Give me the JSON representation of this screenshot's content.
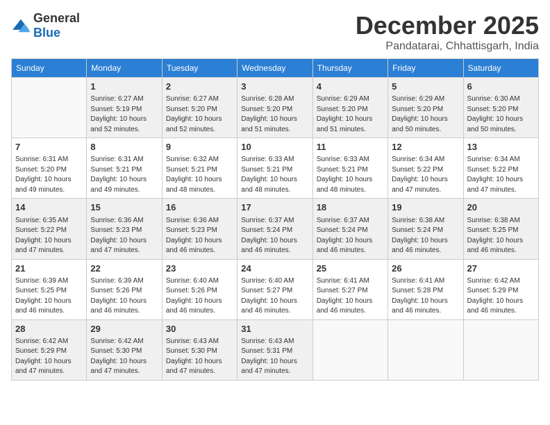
{
  "logo": {
    "general": "General",
    "blue": "Blue"
  },
  "title": "December 2025",
  "location": "Pandatarai, Chhattisgarh, India",
  "headers": [
    "Sunday",
    "Monday",
    "Tuesday",
    "Wednesday",
    "Thursday",
    "Friday",
    "Saturday"
  ],
  "weeks": [
    [
      {
        "day": "",
        "info": ""
      },
      {
        "day": "1",
        "info": "Sunrise: 6:27 AM\nSunset: 5:19 PM\nDaylight: 10 hours\nand 52 minutes."
      },
      {
        "day": "2",
        "info": "Sunrise: 6:27 AM\nSunset: 5:20 PM\nDaylight: 10 hours\nand 52 minutes."
      },
      {
        "day": "3",
        "info": "Sunrise: 6:28 AM\nSunset: 5:20 PM\nDaylight: 10 hours\nand 51 minutes."
      },
      {
        "day": "4",
        "info": "Sunrise: 6:29 AM\nSunset: 5:20 PM\nDaylight: 10 hours\nand 51 minutes."
      },
      {
        "day": "5",
        "info": "Sunrise: 6:29 AM\nSunset: 5:20 PM\nDaylight: 10 hours\nand 50 minutes."
      },
      {
        "day": "6",
        "info": "Sunrise: 6:30 AM\nSunset: 5:20 PM\nDaylight: 10 hours\nand 50 minutes."
      }
    ],
    [
      {
        "day": "7",
        "info": "Sunrise: 6:31 AM\nSunset: 5:20 PM\nDaylight: 10 hours\nand 49 minutes."
      },
      {
        "day": "8",
        "info": "Sunrise: 6:31 AM\nSunset: 5:21 PM\nDaylight: 10 hours\nand 49 minutes."
      },
      {
        "day": "9",
        "info": "Sunrise: 6:32 AM\nSunset: 5:21 PM\nDaylight: 10 hours\nand 48 minutes."
      },
      {
        "day": "10",
        "info": "Sunrise: 6:33 AM\nSunset: 5:21 PM\nDaylight: 10 hours\nand 48 minutes."
      },
      {
        "day": "11",
        "info": "Sunrise: 6:33 AM\nSunset: 5:21 PM\nDaylight: 10 hours\nand 48 minutes."
      },
      {
        "day": "12",
        "info": "Sunrise: 6:34 AM\nSunset: 5:22 PM\nDaylight: 10 hours\nand 47 minutes."
      },
      {
        "day": "13",
        "info": "Sunrise: 6:34 AM\nSunset: 5:22 PM\nDaylight: 10 hours\nand 47 minutes."
      }
    ],
    [
      {
        "day": "14",
        "info": "Sunrise: 6:35 AM\nSunset: 5:22 PM\nDaylight: 10 hours\nand 47 minutes."
      },
      {
        "day": "15",
        "info": "Sunrise: 6:36 AM\nSunset: 5:23 PM\nDaylight: 10 hours\nand 47 minutes."
      },
      {
        "day": "16",
        "info": "Sunrise: 6:36 AM\nSunset: 5:23 PM\nDaylight: 10 hours\nand 46 minutes."
      },
      {
        "day": "17",
        "info": "Sunrise: 6:37 AM\nSunset: 5:24 PM\nDaylight: 10 hours\nand 46 minutes."
      },
      {
        "day": "18",
        "info": "Sunrise: 6:37 AM\nSunset: 5:24 PM\nDaylight: 10 hours\nand 46 minutes."
      },
      {
        "day": "19",
        "info": "Sunrise: 6:38 AM\nSunset: 5:24 PM\nDaylight: 10 hours\nand 46 minutes."
      },
      {
        "day": "20",
        "info": "Sunrise: 6:38 AM\nSunset: 5:25 PM\nDaylight: 10 hours\nand 46 minutes."
      }
    ],
    [
      {
        "day": "21",
        "info": "Sunrise: 6:39 AM\nSunset: 5:25 PM\nDaylight: 10 hours\nand 46 minutes."
      },
      {
        "day": "22",
        "info": "Sunrise: 6:39 AM\nSunset: 5:26 PM\nDaylight: 10 hours\nand 46 minutes."
      },
      {
        "day": "23",
        "info": "Sunrise: 6:40 AM\nSunset: 5:26 PM\nDaylight: 10 hours\nand 46 minutes."
      },
      {
        "day": "24",
        "info": "Sunrise: 6:40 AM\nSunset: 5:27 PM\nDaylight: 10 hours\nand 46 minutes."
      },
      {
        "day": "25",
        "info": "Sunrise: 6:41 AM\nSunset: 5:27 PM\nDaylight: 10 hours\nand 46 minutes."
      },
      {
        "day": "26",
        "info": "Sunrise: 6:41 AM\nSunset: 5:28 PM\nDaylight: 10 hours\nand 46 minutes."
      },
      {
        "day": "27",
        "info": "Sunrise: 6:42 AM\nSunset: 5:29 PM\nDaylight: 10 hours\nand 46 minutes."
      }
    ],
    [
      {
        "day": "28",
        "info": "Sunrise: 6:42 AM\nSunset: 5:29 PM\nDaylight: 10 hours\nand 47 minutes."
      },
      {
        "day": "29",
        "info": "Sunrise: 6:42 AM\nSunset: 5:30 PM\nDaylight: 10 hours\nand 47 minutes."
      },
      {
        "day": "30",
        "info": "Sunrise: 6:43 AM\nSunset: 5:30 PM\nDaylight: 10 hours\nand 47 minutes."
      },
      {
        "day": "31",
        "info": "Sunrise: 6:43 AM\nSunset: 5:31 PM\nDaylight: 10 hours\nand 47 minutes."
      },
      {
        "day": "",
        "info": ""
      },
      {
        "day": "",
        "info": ""
      },
      {
        "day": "",
        "info": ""
      }
    ]
  ]
}
